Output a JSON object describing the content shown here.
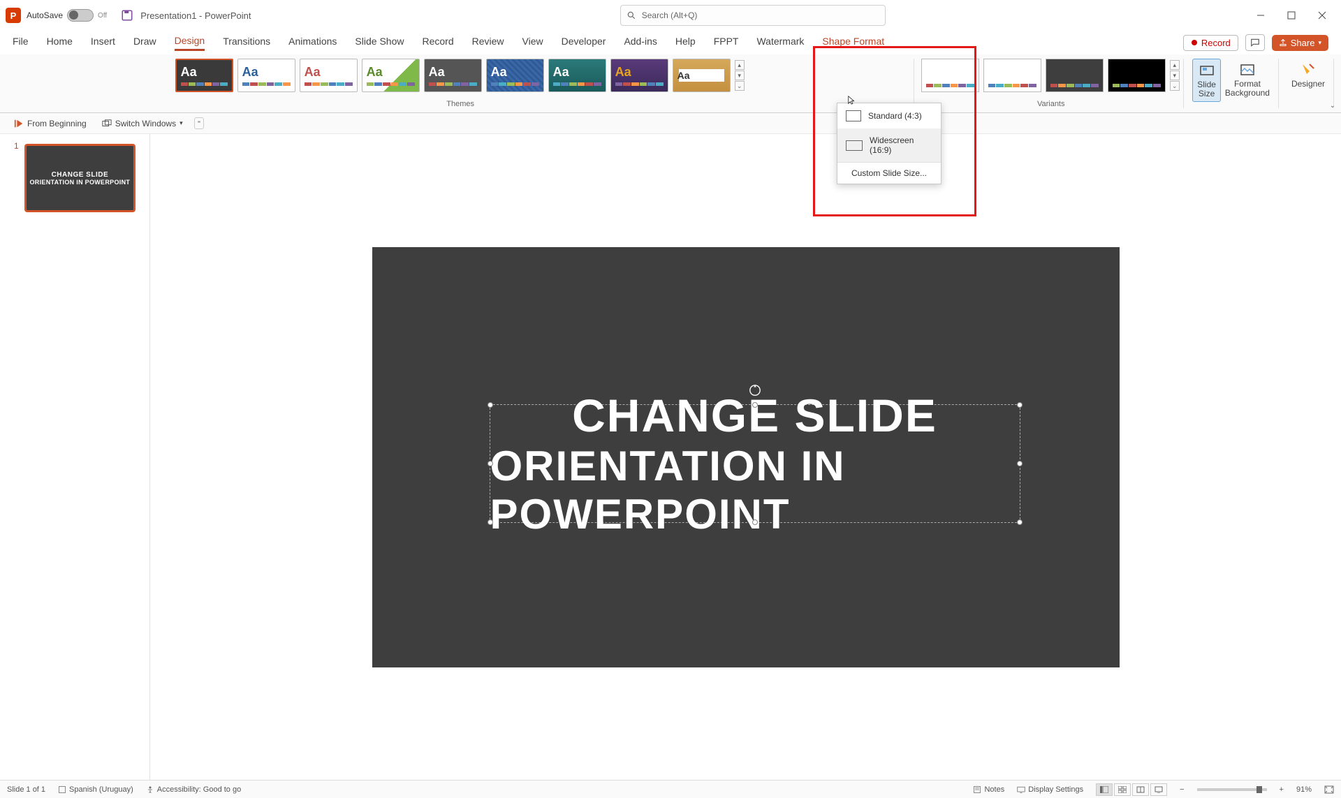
{
  "titlebar": {
    "autosave_label": "AutoSave",
    "autosave_state": "Off",
    "doc_title": "Presentation1 - PowerPoint",
    "search_placeholder": "Search (Alt+Q)"
  },
  "tabs": {
    "file": "File",
    "home": "Home",
    "insert": "Insert",
    "draw": "Draw",
    "design": "Design",
    "transitions": "Transitions",
    "animations": "Animations",
    "slideshow": "Slide Show",
    "record": "Record",
    "review": "Review",
    "view": "View",
    "developer": "Developer",
    "addins": "Add-ins",
    "help": "Help",
    "fppt": "FPPT",
    "watermark": "Watermark",
    "shape_format": "Shape Format"
  },
  "tabs_right": {
    "record": "Record",
    "share": "Share"
  },
  "ribbon": {
    "themes_label": "Themes",
    "variants_label": "Variants",
    "theme_text": "Aa",
    "slide_size": "Slide\nSize",
    "format_bg": "Format\nBackground",
    "designer": "Designer"
  },
  "qat": {
    "from_beginning": "From Beginning",
    "switch_windows": "Switch Windows"
  },
  "dropdown": {
    "standard": "Standard (4:3)",
    "widescreen": "Widescreen (16:9)",
    "custom": "Custom Slide Size..."
  },
  "slide": {
    "number": "1",
    "line1": "CHANGE SLIDE",
    "line2": "ORIENTATION IN POWERPOINT"
  },
  "statusbar": {
    "slide_of": "Slide 1 of 1",
    "language": "Spanish (Uruguay)",
    "accessibility": "Accessibility: Good to go",
    "notes": "Notes",
    "display_settings": "Display Settings",
    "zoom": "91%"
  },
  "colors": {
    "accent_orange": "#d35429",
    "accent_red": "#e31818"
  }
}
